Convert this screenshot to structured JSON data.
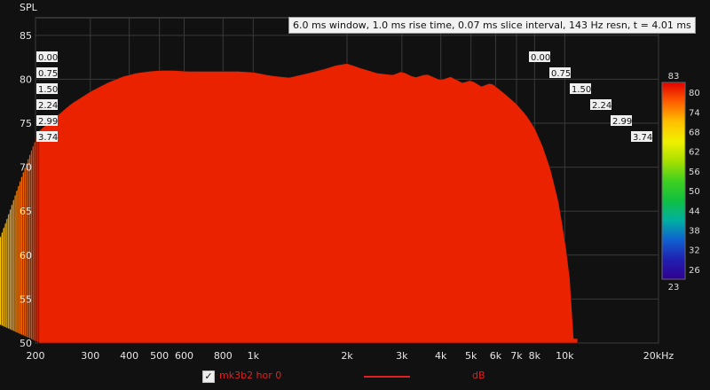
{
  "header": {
    "info": "6.0 ms window, 1.0 ms rise time, 0.07 ms slice interval, 143 Hz resn, t = 4.01 ms"
  },
  "legend": {
    "checked": true,
    "series_name": "mk3b2 hor 0",
    "unit": "dB",
    "line_color": "#e02020"
  },
  "chart_data": {
    "type": "area",
    "subtype": "cumulative-spectral-decay-waterfall",
    "title": "",
    "ylabel": "SPL",
    "xlabel": "",
    "x_scale": "log",
    "xlim": [
      200,
      20000
    ],
    "ylim": [
      50,
      87
    ],
    "x_ticks": [
      {
        "v": 200,
        "label": "200"
      },
      {
        "v": 300,
        "label": "300"
      },
      {
        "v": 400,
        "label": "400"
      },
      {
        "v": 500,
        "label": "500"
      },
      {
        "v": 600,
        "label": "600"
      },
      {
        "v": 800,
        "label": "800"
      },
      {
        "v": 1000,
        "label": "1k"
      },
      {
        "v": 2000,
        "label": "2k"
      },
      {
        "v": 3000,
        "label": "3k"
      },
      {
        "v": 4000,
        "label": "4k"
      },
      {
        "v": 5000,
        "label": "5k"
      },
      {
        "v": 6000,
        "label": "6k"
      },
      {
        "v": 7000,
        "label": "7k"
      },
      {
        "v": 8000,
        "label": "8k"
      },
      {
        "v": 10000,
        "label": "10k"
      },
      {
        "v": 20000,
        "label": "20kHz"
      }
    ],
    "y_ticks": [
      50,
      55,
      60,
      65,
      70,
      75,
      80,
      85
    ],
    "time_axis_labels": [
      "0.00",
      "0.75",
      "1.50",
      "2.24",
      "2.99",
      "3.74"
    ],
    "time_range_ms": [
      0,
      4.01
    ],
    "slice_count": 58,
    "front_response": {
      "x": [
        200,
        230,
        260,
        300,
        340,
        380,
        420,
        460,
        500,
        560,
        620,
        700,
        800,
        900,
        1000,
        1150,
        1300,
        1500,
        1700,
        1850,
        2000,
        2200,
        2500,
        2800,
        3000,
        3300,
        3600,
        4000,
        4300,
        4700,
        5000,
        5400,
        5800,
        6200,
        6600,
        7000,
        7500,
        8000,
        8500,
        9000,
        9500,
        10000,
        10500
      ],
      "y": [
        73.8,
        75.6,
        77.2,
        78.6,
        79.6,
        80.3,
        80.7,
        80.9,
        81.0,
        81.0,
        80.9,
        80.9,
        80.9,
        80.9,
        80.8,
        80.4,
        80.2,
        80.7,
        81.2,
        81.6,
        81.8,
        81.3,
        80.7,
        80.5,
        80.9,
        80.2,
        80.6,
        79.9,
        80.3,
        79.6,
        79.9,
        79.2,
        79.6,
        78.8,
        78.0,
        77.2,
        76.0,
        74.5,
        72.4,
        69.8,
        66.5,
        62.0,
        56.0
      ]
    },
    "colorbar": {
      "ticks": [
        83,
        80,
        74,
        68,
        62,
        56,
        50,
        44,
        38,
        32,
        26,
        23
      ],
      "range": [
        23,
        83
      ],
      "colors": [
        "#e00000",
        "#ff6000",
        "#ffc000",
        "#f0f000",
        "#a8e000",
        "#40d020",
        "#10c040",
        "#00b0a0",
        "#1060d0",
        "#2020b0",
        "#300090"
      ]
    }
  }
}
